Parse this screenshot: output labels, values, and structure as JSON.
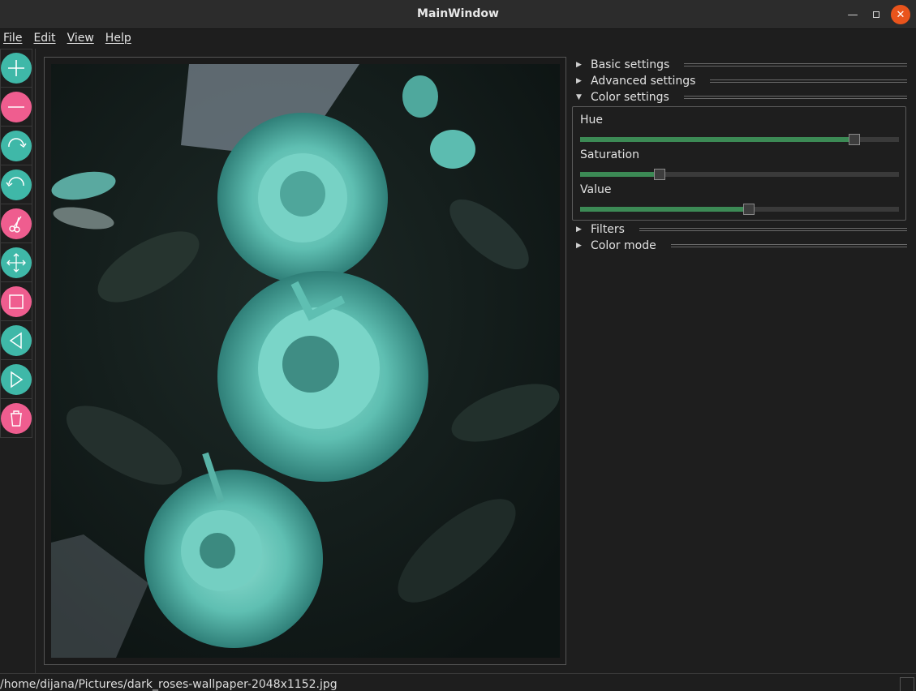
{
  "window": {
    "title": "MainWindow"
  },
  "menu": {
    "file": "File",
    "edit": "Edit",
    "view": "View",
    "help": "Help"
  },
  "toolbar": {
    "tools": [
      {
        "icon": "plus-icon",
        "color": "#3fb8a8"
      },
      {
        "icon": "minus-icon",
        "color": "#ef5d8f"
      },
      {
        "icon": "rotate-right-icon",
        "color": "#3fb8a8"
      },
      {
        "icon": "rotate-left-icon",
        "color": "#3fb8a8"
      },
      {
        "icon": "scissors-icon",
        "color": "#ef5d8f"
      },
      {
        "icon": "move-arrows-icon",
        "color": "#3fb8a8"
      },
      {
        "icon": "square-icon",
        "color": "#ef5d8f"
      },
      {
        "icon": "triangle-left-icon",
        "color": "#3fb8a8"
      },
      {
        "icon": "triangle-right-icon",
        "color": "#3fb8a8"
      },
      {
        "icon": "trash-icon",
        "color": "#ef5d8f"
      }
    ]
  },
  "panel": {
    "basic": {
      "label": "Basic settings",
      "expanded": false
    },
    "advanced": {
      "label": "Advanced settings",
      "expanded": false
    },
    "color": {
      "label": "Color settings",
      "expanded": true
    },
    "sliders": {
      "hue": {
        "label": "Hue",
        "value": 0.86
      },
      "saturation": {
        "label": "Saturation",
        "value": 0.25
      },
      "value": {
        "label": "Value",
        "value": 0.53
      }
    },
    "filters": {
      "label": "Filters",
      "expanded": false
    },
    "colormode": {
      "label": "Color mode",
      "expanded": false
    }
  },
  "image": {
    "subject": "teal-tinted roses photo"
  },
  "status": {
    "path": "/home/dijana/Pictures/dark_roses-wallpaper-2048x1152.jpg"
  },
  "colors": {
    "accent_teal": "#3fb8a8",
    "accent_pink": "#ef5d8f",
    "slider_fill": "#3c8a55",
    "close_button": "#e9541c"
  }
}
